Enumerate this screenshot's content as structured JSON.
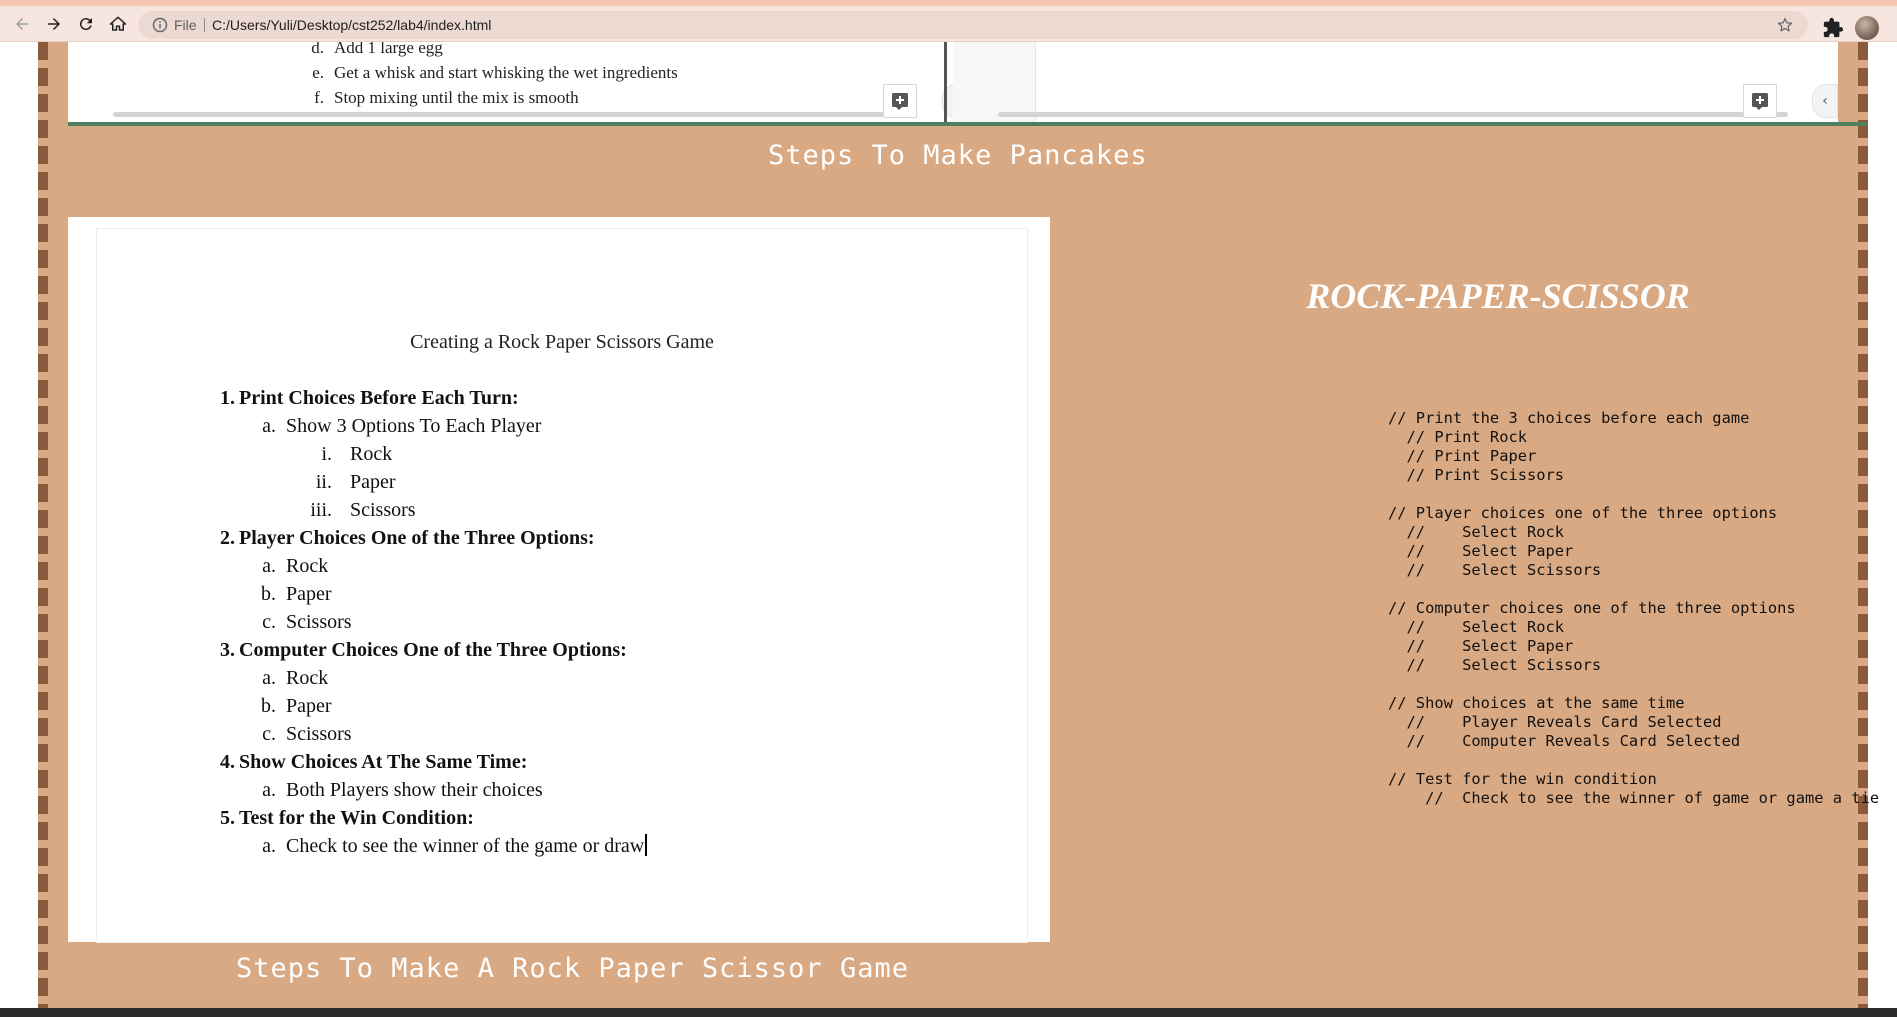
{
  "browser": {
    "file_label": "File",
    "url": "C:/Users/Yuli/Desktop/cst252/lab4/index.html"
  },
  "top_embed": {
    "partial_items": [
      {
        "marker": "d.",
        "text": "Add 1 large egg"
      },
      {
        "marker": "e.",
        "text": "Get a whisk and start whisking the wet ingredients"
      },
      {
        "marker": "f.",
        "text": "Stop mixing until the mix is smooth"
      }
    ],
    "collapse_glyph": "‹"
  },
  "pancakes_caption": "Steps To Make Pancakes",
  "rps_doc": {
    "title": "Creating a Rock Paper Scissors Game",
    "steps": [
      {
        "marker": "1.",
        "label": "Print Choices Before Each Turn:",
        "sub": [
          {
            "marker": "a.",
            "label": "Show 3 Options To Each Player",
            "sub": [
              {
                "marker": "i.",
                "label": "Rock"
              },
              {
                "marker": "ii.",
                "label": "Paper"
              },
              {
                "marker": "iii.",
                "label": "Scissors"
              }
            ]
          }
        ]
      },
      {
        "marker": "2.",
        "label": "Player Choices One of the Three Options:",
        "sub": [
          {
            "marker": "a.",
            "label": "Rock"
          },
          {
            "marker": "b.",
            "label": "Paper"
          },
          {
            "marker": "c.",
            "label": "Scissors"
          }
        ]
      },
      {
        "marker": "3.",
        "label": "Computer Choices One of the Three Options:",
        "sub": [
          {
            "marker": "a.",
            "label": "Rock"
          },
          {
            "marker": "b.",
            "label": "Paper"
          },
          {
            "marker": "c.",
            "label": "Scissors"
          }
        ]
      },
      {
        "marker": "4.",
        "label": "Show Choices At The Same Time:",
        "sub": [
          {
            "marker": "a.",
            "label": "Both Players show their choices"
          }
        ]
      },
      {
        "marker": "5.",
        "label": "Test for the Win Condition:",
        "sub": [
          {
            "marker": "a.",
            "label": "Check to see the winner of the game or draw"
          }
        ]
      }
    ]
  },
  "rps_heading": "ROCK-PAPER-SCISSOR",
  "pseudocode": "// Print the 3 choices before each game\n  // Print Rock\n  // Print Paper\n  // Print Scissors\n\n// Player choices one of the three options\n  //    Select Rock\n  //    Select Paper\n  //    Select Scissors\n\n// Computer choices one of the three options\n  //    Select Rock\n  //    Select Paper\n  //    Select Scissors\n\n// Show choices at the same time\n  //    Player Reveals Card Selected\n  //    Computer Reveals Card Selected\n\n// Test for the win condition\n    //  Check to see the winner of game or game a tie",
  "rps_caption": "Steps To Make A Rock Paper Scissor Game",
  "colors": {
    "page_background": "#d9a983",
    "border_stripe": "#8a5a3c",
    "caption_text": "#ffffff"
  }
}
